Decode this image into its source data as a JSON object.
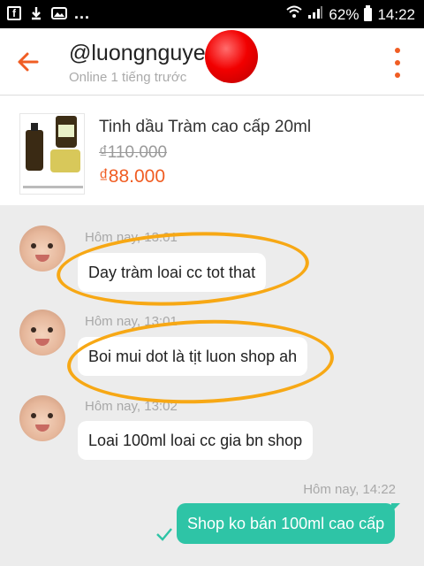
{
  "status_bar": {
    "left_icons": [
      "facebook-icon",
      "download-icon",
      "photo-icon"
    ],
    "overflow": "...",
    "wifi_icon": "wifi-icon",
    "signal_icon": "signal-icon",
    "battery_percent": "62%",
    "time": "14:22"
  },
  "header": {
    "title": "@luongnguyen",
    "subtitle": "Online 1 tiếng trước"
  },
  "product": {
    "name": "Tinh dầu Tràm cao cấp 20ml",
    "old_price": "₫110.000",
    "new_price": "₫88.000"
  },
  "messages": [
    {
      "direction": "in",
      "time": "Hôm nay, 13:01",
      "text": "Day tràm loai cc tot that"
    },
    {
      "direction": "in",
      "time": "Hôm nay, 13:01",
      "text": "Boi mui dot là tịt luon shop ah"
    },
    {
      "direction": "in",
      "time": "Hôm nay, 13:02",
      "text": "Loai 100ml loai cc gia bn shop"
    },
    {
      "direction": "out",
      "time": "Hôm nay, 14:22",
      "text": "Shop ko bán 100ml cao  cấp"
    }
  ],
  "colors": {
    "accent": "#f05d23",
    "outgoing_bubble": "#2ec4a6",
    "annotation": "#f7a815",
    "chat_background": "#ececec"
  }
}
